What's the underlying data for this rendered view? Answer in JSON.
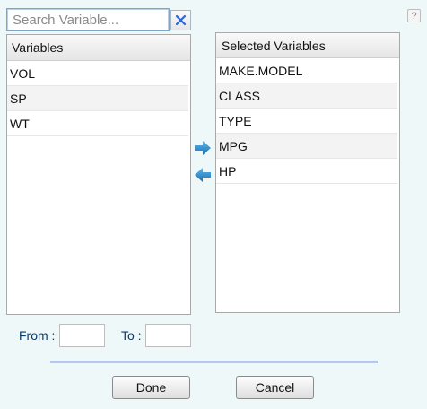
{
  "search": {
    "placeholder": "Search Variable..."
  },
  "help": {
    "label": "?"
  },
  "available": {
    "header": "Variables",
    "items": [
      {
        "label": "VOL"
      },
      {
        "label": "SP"
      },
      {
        "label": "WT"
      }
    ]
  },
  "selected": {
    "header": "Selected Variables",
    "items": [
      {
        "label": "MAKE.MODEL"
      },
      {
        "label": "CLASS"
      },
      {
        "label": "TYPE"
      },
      {
        "label": "MPG"
      },
      {
        "label": "HP"
      }
    ]
  },
  "range": {
    "from_label": "From :",
    "to_label": "To :"
  },
  "buttons": {
    "done": "Done",
    "cancel": "Cancel"
  },
  "icons": {
    "clear": "close-icon",
    "move_right": "arrow-right-icon",
    "move_left": "arrow-left-icon"
  },
  "colors": {
    "background": "#eef8f8",
    "arrow": "#2b8fd0",
    "clear_x": "#2f64d6",
    "range_label": "#0b3a6a"
  }
}
